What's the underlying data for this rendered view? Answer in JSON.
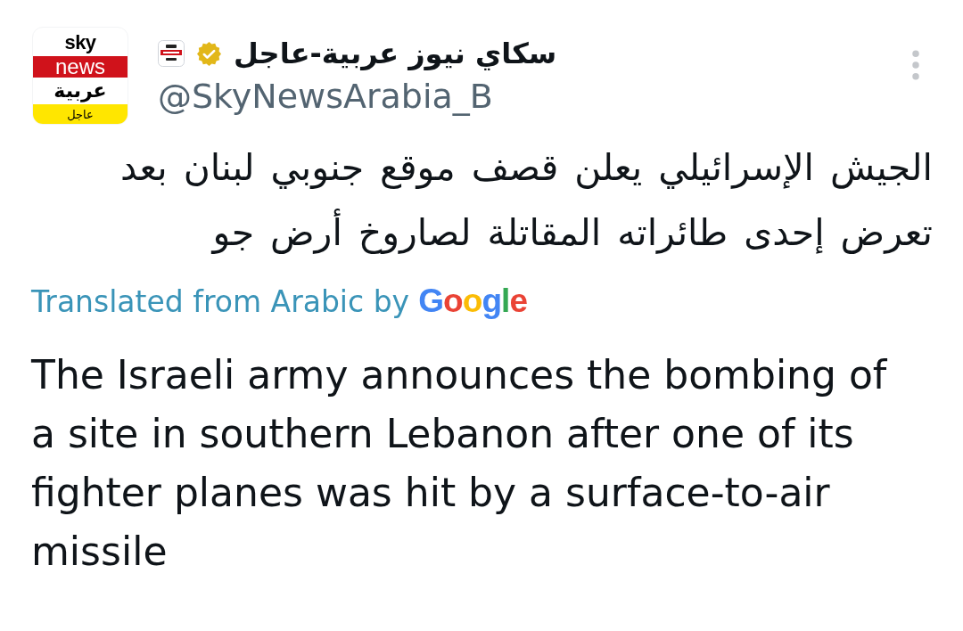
{
  "post": {
    "avatar": {
      "lines": [
        {
          "text": "sky",
          "kind": "plain"
        },
        {
          "text": "news",
          "kind": "banner"
        },
        {
          "text": "عربية",
          "kind": "plain"
        },
        {
          "text": "عاجل",
          "kind": "footer"
        }
      ]
    },
    "author": {
      "name": "سكاي نيوز عربية-عاجل",
      "handle": "@SkyNewsArabia_B",
      "verified": true,
      "affiliate_badge": true
    },
    "text": "الجيش الإسرائيلي يعلن قصف موقع جنوبي لبنان بعد تعرض إحدى طائراته المقاتلة لصاروخ أرض جو",
    "translation": {
      "label": "Translated from Arabic by",
      "provider": "Google",
      "text": "The Israeli army announces the bombing of a site in southern Lebanon after one of its fighter planes was hit by a surface-to-air missile"
    }
  }
}
